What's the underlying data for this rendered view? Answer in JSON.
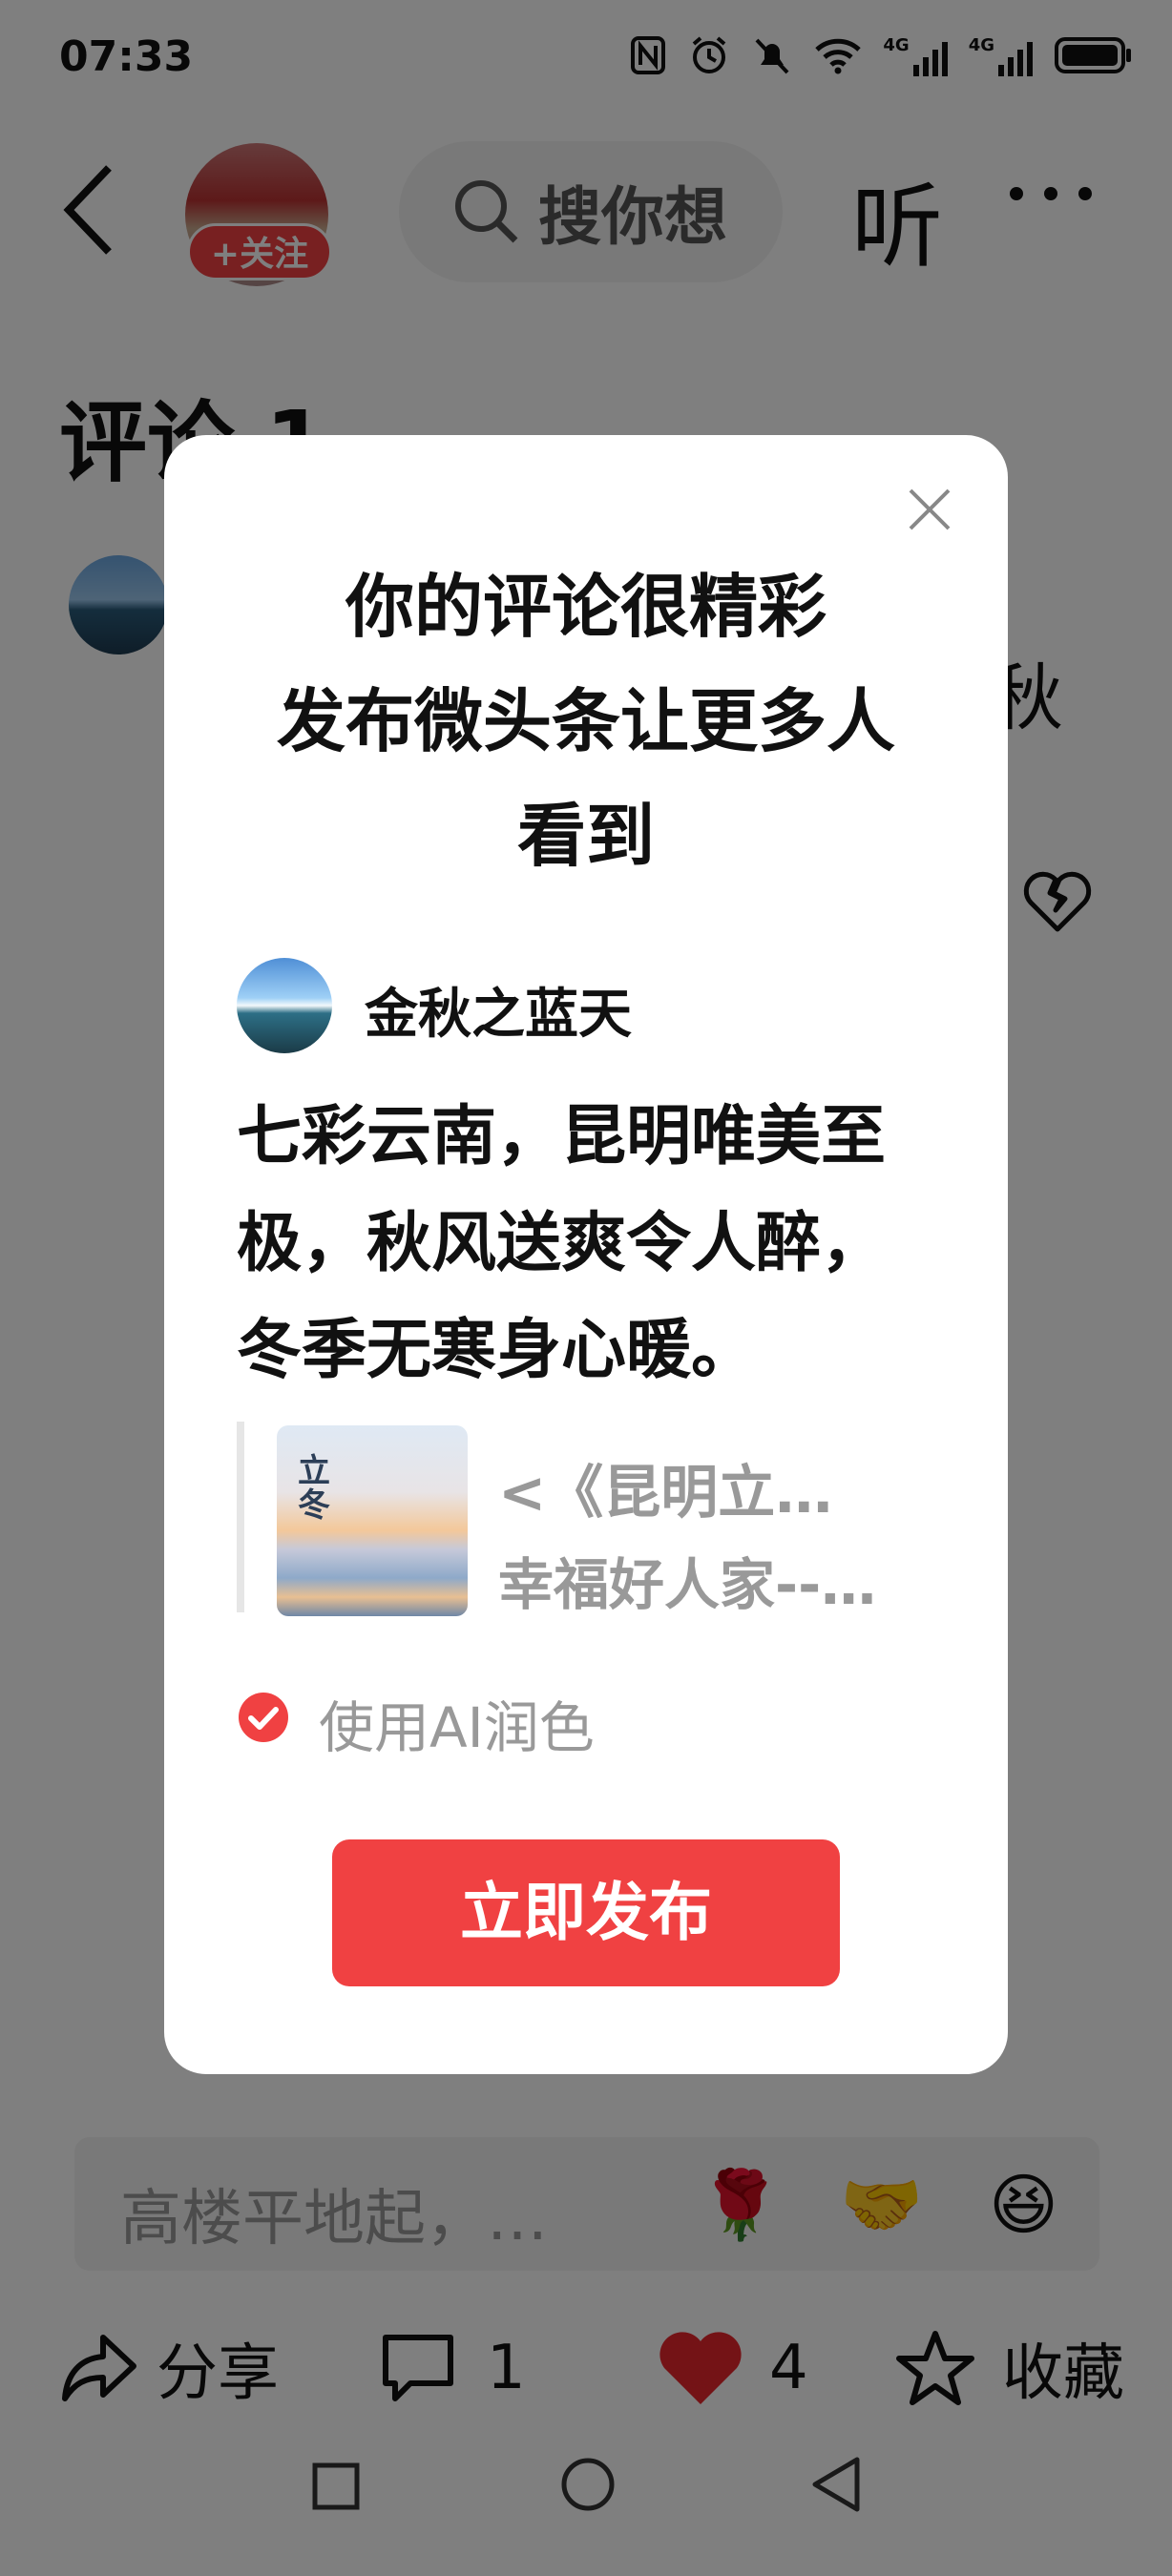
{
  "status_bar": {
    "time": "07:33",
    "signal1": "4G",
    "signal2": "4G"
  },
  "header": {
    "follow_label": "+关注",
    "search_placeholder": "搜你想",
    "listen_label": "听"
  },
  "comments": {
    "title": "评论 1",
    "partial_text": "秋"
  },
  "modal": {
    "title_lines": [
      "你的评论很精彩",
      "发布微头条让更多人",
      "看到"
    ],
    "username": "金秋之蓝天",
    "comment_lines": [
      "七彩云南，昆明唯美至",
      "极，秋风送爽令人醉，",
      "冬季无寒身心暖。"
    ],
    "quote_title": "<《昆明立…",
    "quote_sub": "幸福好人家--…",
    "thumb_text": "立冬",
    "ai_label": "使用AI润色",
    "publish_label": "立即发布"
  },
  "input": {
    "placeholder": "高楼平地起，…",
    "emojis": [
      "🌹",
      "🤝",
      "😆"
    ]
  },
  "actions": {
    "share_label": "分享",
    "comment_count": "1",
    "like_count": "4",
    "collect_label": "收藏"
  },
  "colors": {
    "accent": "#f04142",
    "overlay": "rgba(0,0,0,0.5)"
  }
}
